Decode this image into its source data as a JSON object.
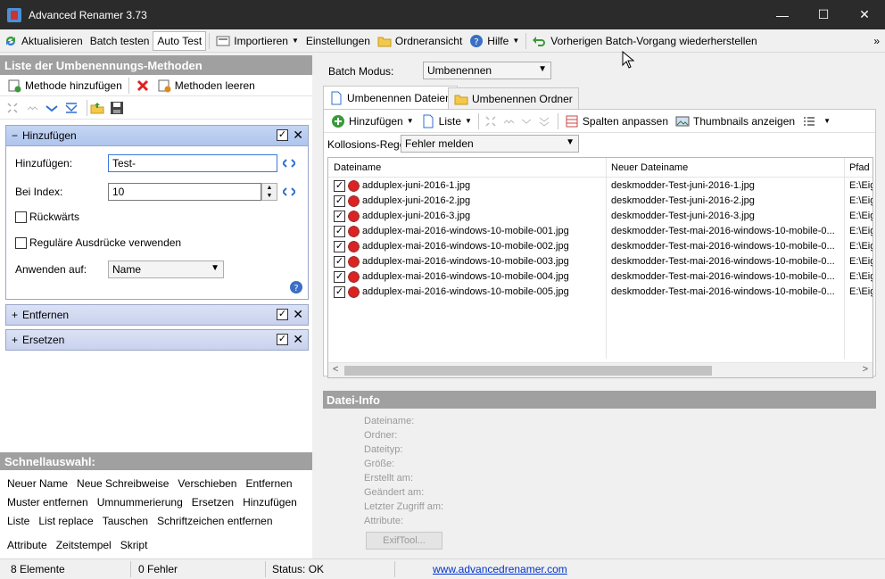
{
  "window": {
    "title": "Advanced Renamer 3.73",
    "minimize": "—",
    "maximize": "☐",
    "close": "✕"
  },
  "toolbar": {
    "refresh": "Aktualisieren",
    "test_batch": "Batch testen",
    "auto_test": "Auto Test",
    "import": "Importieren",
    "settings": "Einstellungen",
    "folder_view": "Ordneransicht",
    "help": "Hilfe",
    "restore": "Vorherigen Batch-Vorgang wiederherstellen",
    "more": "»"
  },
  "methods_panel": {
    "title": "Liste der Umbenennungs-Methoden",
    "add_method": "Methode hinzufügen",
    "clear_methods": "Methoden leeren"
  },
  "methods": [
    {
      "sign": "−",
      "name": "Hinzufügen",
      "checked": "✓",
      "fields": {
        "add_label": "Hinzufügen:",
        "add_value": "Test-",
        "index_label": "Bei Index:",
        "index_value": "10",
        "backwards_label": "Rückwärts",
        "regex_label": "Reguläre Ausdrücke verwenden",
        "apply_label": "Anwenden auf:",
        "apply_value": "Name"
      }
    },
    {
      "sign": "+",
      "name": "Entfernen",
      "checked": "✓"
    },
    {
      "sign": "+",
      "name": "Ersetzen",
      "checked": "✓"
    }
  ],
  "quick_select": {
    "title": "Schnellauswahl:",
    "rows": [
      [
        "Neuer Name",
        "Neue Schreibweise",
        "Verschieben",
        "Entfernen"
      ],
      [
        "Muster entfernen",
        "Umnummerierung",
        "Ersetzen",
        "Hinzufügen"
      ],
      [
        "Liste",
        "List replace",
        "Tauschen",
        "Schriftzeichen entfernen"
      ],
      [
        "Attribute",
        "Zeitstempel",
        "Skript"
      ]
    ]
  },
  "batch": {
    "label": "Batch Modus:",
    "value": "Umbenennen"
  },
  "tabs": {
    "files": "Umbenennen Dateien",
    "folders": "Umbenennen Ordner"
  },
  "files_toolbar": {
    "add": "Hinzufügen",
    "list": "Liste",
    "fit_columns": "Spalten anpassen",
    "thumbnails": "Thumbnails anzeigen"
  },
  "collision": {
    "label": "Kollosions-Regel:",
    "value": "Fehler melden"
  },
  "file_grid": {
    "columns": [
      "Dateiname",
      "Neuer Dateiname",
      "Pfad"
    ],
    "rows": [
      {
        "check": "✓",
        "name": "adduplex-juni-2016-1.jpg",
        "new_name": "deskmodder-Test-juni-2016-1.jpg",
        "path": "E:\\Eige"
      },
      {
        "check": "✓",
        "name": "adduplex-juni-2016-2.jpg",
        "new_name": "deskmodder-Test-juni-2016-2.jpg",
        "path": "E:\\Eige"
      },
      {
        "check": "✓",
        "name": "adduplex-juni-2016-3.jpg",
        "new_name": "deskmodder-Test-juni-2016-3.jpg",
        "path": "E:\\Eige"
      },
      {
        "check": "✓",
        "name": "adduplex-mai-2016-windows-10-mobile-001.jpg",
        "new_name": "deskmodder-Test-mai-2016-windows-10-mobile-0...",
        "path": "E:\\Eige"
      },
      {
        "check": "✓",
        "name": "adduplex-mai-2016-windows-10-mobile-002.jpg",
        "new_name": "deskmodder-Test-mai-2016-windows-10-mobile-0...",
        "path": "E:\\Eige"
      },
      {
        "check": "✓",
        "name": "adduplex-mai-2016-windows-10-mobile-003.jpg",
        "new_name": "deskmodder-Test-mai-2016-windows-10-mobile-0...",
        "path": "E:\\Eige"
      },
      {
        "check": "✓",
        "name": "adduplex-mai-2016-windows-10-mobile-004.jpg",
        "new_name": "deskmodder-Test-mai-2016-windows-10-mobile-0...",
        "path": "E:\\Eige"
      },
      {
        "check": "✓",
        "name": "adduplex-mai-2016-windows-10-mobile-005.jpg",
        "new_name": "deskmodder-Test-mai-2016-windows-10-mobile-0...",
        "path": "E:\\Eige"
      }
    ],
    "scroll_left": "<",
    "scroll_right": ">"
  },
  "file_info": {
    "title": "Datei-Info",
    "labels": [
      "Dateiname:",
      "Ordner:",
      "Dateityp:",
      "Größe:",
      "Erstellt am:",
      "Geändert am:",
      "Letzter Zugriff am:",
      "Attribute:"
    ],
    "exiftool": "ExifTool..."
  },
  "status": {
    "items": "8 Elemente",
    "errors": "0 Fehler",
    "state": "Status: OK",
    "url": "www.advancedrenamer.com"
  }
}
